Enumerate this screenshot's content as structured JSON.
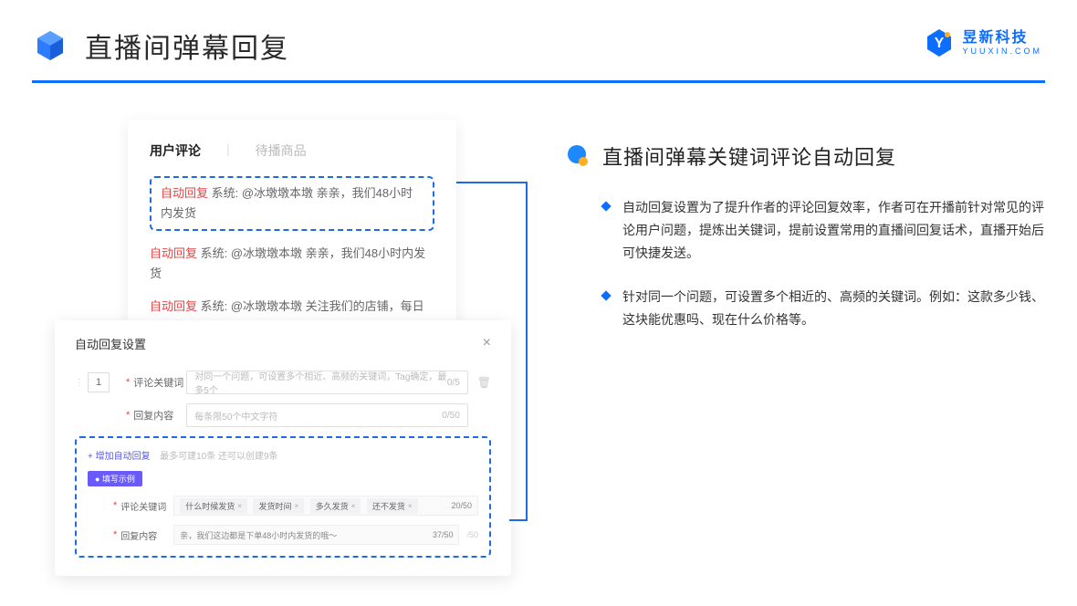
{
  "header": {
    "title": "直播间弹幕回复"
  },
  "logo": {
    "cn": "昱新科技",
    "en": "YUUXIN.COM"
  },
  "card1": {
    "tabs": {
      "active": "用户评论",
      "inactive": "待播商品"
    },
    "highlighted": {
      "tag": "自动回复",
      "text": " 系统: @冰墩墩本墩 亲亲，我们48小时内发货"
    },
    "rows": [
      {
        "tag": "自动回复",
        "text": " 系统: @冰墩墩本墩 亲亲，我们48小时内发货"
      },
      {
        "tag": "自动回复",
        "text": " 系统: @冰墩墩本墩 关注我们的店铺，每日都有热门推荐呦～"
      }
    ]
  },
  "card2": {
    "title": "自动回复设置",
    "close": "×",
    "num": "1",
    "label1": "评论关键词",
    "placeholder1": "对同一个问题，可设置多个相近、高频的关键词，Tag确定，最多5个",
    "counter1": "0/5",
    "label2": "回复内容",
    "placeholder2": "每条限50个中文字符",
    "counter2": "0/50",
    "addLink": "+ 增加自动回复",
    "addDesc": "最多可建10条 还可以创建9条",
    "exampleBadge": "● 填写示例",
    "exLabel1": "评论关键词",
    "exTags": [
      "什么时候发货",
      "发货时间",
      "多久发货",
      "还不发货"
    ],
    "exCounter1": "20/50",
    "exLabel2": "回复内容",
    "exValue2": "亲，我们这边都是下单48小时内发货的哦～",
    "exCounter2": "37/50",
    "counter3": "/50"
  },
  "section": {
    "title": "直播间弹幕关键词评论自动回复",
    "points": [
      "自动回复设置为了提升作者的评论回复效率，作者可在开播前针对常见的评论用户问题，提炼出关键词，提前设置常用的直播间回复话术，直播开始后可快捷发送。",
      "针对同一个问题，可设置多个相近的、高频的关键词。例如：这款多少钱、这块能优惠吗、现在什么价格等。"
    ]
  }
}
